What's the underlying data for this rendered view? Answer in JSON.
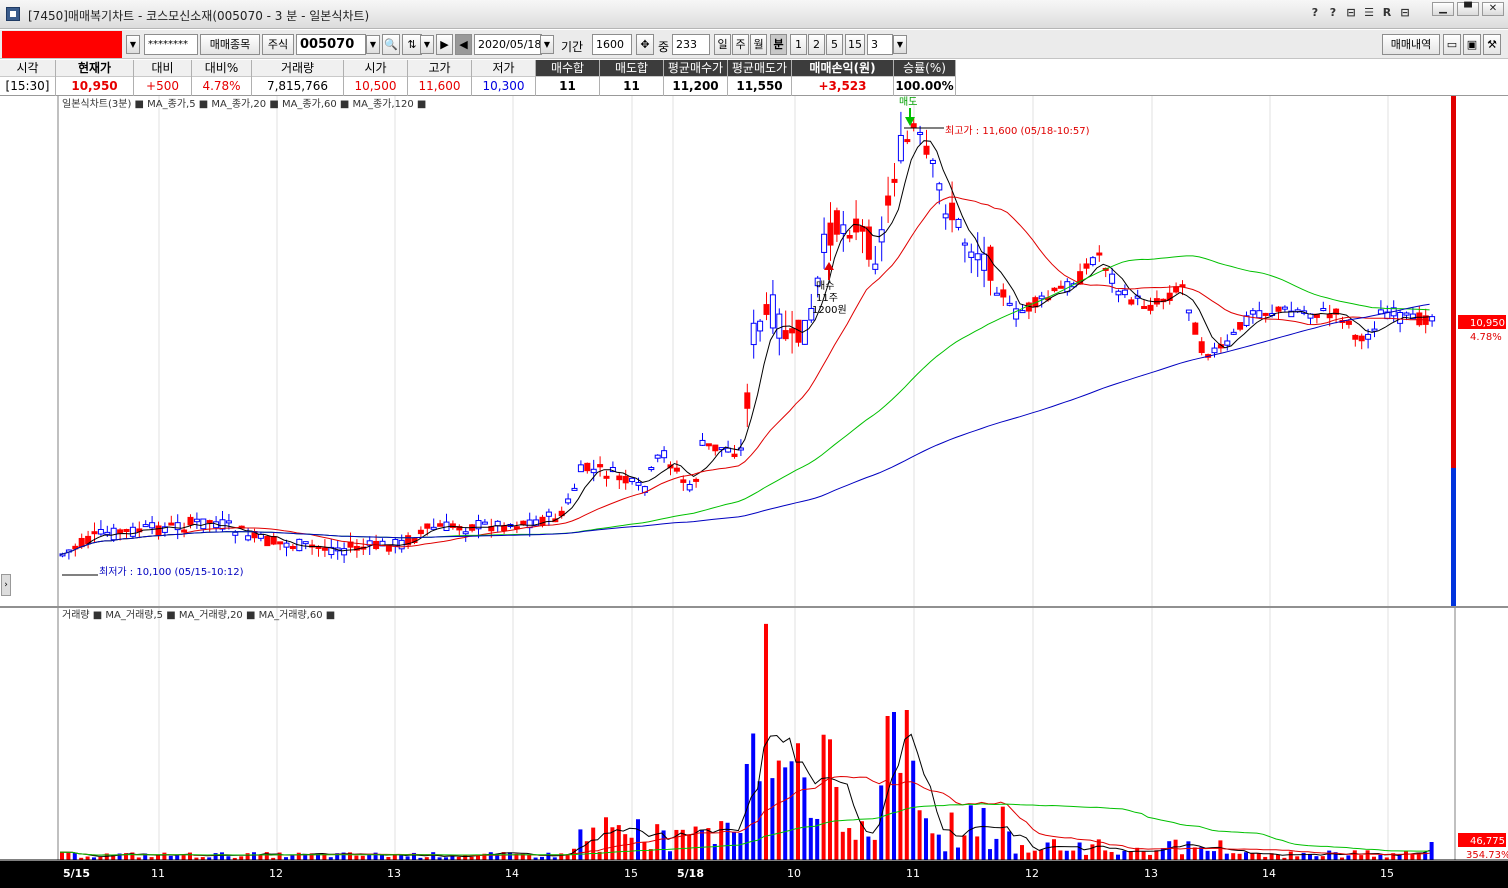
{
  "window": {
    "title": "[7450]매매복기차트 - 코스모신소재(005070 - 3 분 - 일본식차트)",
    "icons": [
      "?",
      "?",
      "⊟",
      "☰",
      "R",
      "⊟"
    ]
  },
  "toolbar": {
    "password": "********",
    "stock_select_label": "매매종목",
    "market_label": "주식",
    "code": "005070",
    "date": "2020/05/18",
    "period_label": "기간",
    "period_value": "1600",
    "count_label": "중",
    "count_value": "233",
    "periods": [
      "일",
      "주",
      "월",
      "분",
      "1",
      "2",
      "5",
      "15",
      "3"
    ],
    "active_period": "분",
    "history_button": "매매내역"
  },
  "info": {
    "time_label": "시각",
    "time_value": "[15:30]",
    "price_label": "현재가",
    "price_value": "10,950",
    "change_label": "대비",
    "change_value": "+500",
    "change_pct_label": "대비%",
    "change_pct_value": "4.78%",
    "volume_label": "거래량",
    "volume_value": "7,815,766",
    "open_label": "시가",
    "open_value": "10,500",
    "high_label": "고가",
    "high_value": "11,600",
    "low_label": "저가",
    "low_value": "10,300",
    "buy_sum_label": "매수합",
    "buy_sum_value": "11",
    "sell_sum_label": "매도합",
    "sell_sum_value": "11",
    "avg_buy_label": "평균매수가",
    "avg_buy_value": "11,200",
    "avg_sell_label": "평균매도가",
    "avg_sell_value": "11,550",
    "pnl_label": "매매손익(원)",
    "pnl_value": "+3,523",
    "winrate_label": "승률(%)",
    "winrate_value": "100.00%"
  },
  "colors": {
    "up": "#ff0000",
    "down": "#0000ff",
    "ma5": "#000000",
    "ma20": "#e00000",
    "ma60": "#00c000",
    "ma120": "#0000c0"
  },
  "chart": {
    "price_legend": "일본식차트(3분) ■ MA_종가,5 ■ MA_종가,20 ■ MA_종가,60 ■ MA_종가,120 ■",
    "volume_legend": "거래량 ■ MA_거래량,5 ■ MA_거래량,20 ■ MA_거래량,60 ■",
    "high_marker": "최고가 : 11,600 (05/18-10:57)",
    "low_marker": "최저가 : 10,100 (05/15-10:12)",
    "buy_label": [
      "매수",
      "11주",
      "1200원"
    ],
    "sell_label": "매도",
    "last_price": "10,950",
    "last_pct": "4.78%",
    "last_volume": "46,775",
    "last_volume_pct": "354.73%",
    "x_ticks": [
      "5/15",
      "11",
      "12",
      "13",
      "14",
      "15",
      "5/18",
      "10",
      "11",
      "12",
      "13",
      "14",
      "15"
    ]
  },
  "chart_data": {
    "type": "candlestick",
    "symbol": "005070",
    "interval": "3 분",
    "sessions": [
      "5/15",
      "5/18"
    ],
    "x_ticks": [
      "5/15",
      "11",
      "12",
      "13",
      "14",
      "15",
      "5/18",
      "10",
      "11",
      "12",
      "13",
      "14",
      "15"
    ],
    "series": [
      {
        "name": "MA_종가,5"
      },
      {
        "name": "MA_종가,20"
      },
      {
        "name": "MA_종가,60"
      },
      {
        "name": "MA_종가,120"
      },
      {
        "name": "거래량"
      },
      {
        "name": "MA_거래량,5"
      },
      {
        "name": "MA_거래량,20"
      },
      {
        "name": "MA_거래량,60"
      }
    ],
    "high": {
      "price": 11600,
      "time": "05/18-10:57"
    },
    "low": {
      "price": 10100,
      "time": "05/15-10:12"
    },
    "last_close": 10950,
    "last_change_pct": 4.78,
    "last_volume": 46775,
    "last_volume_pct": 354.73
  }
}
